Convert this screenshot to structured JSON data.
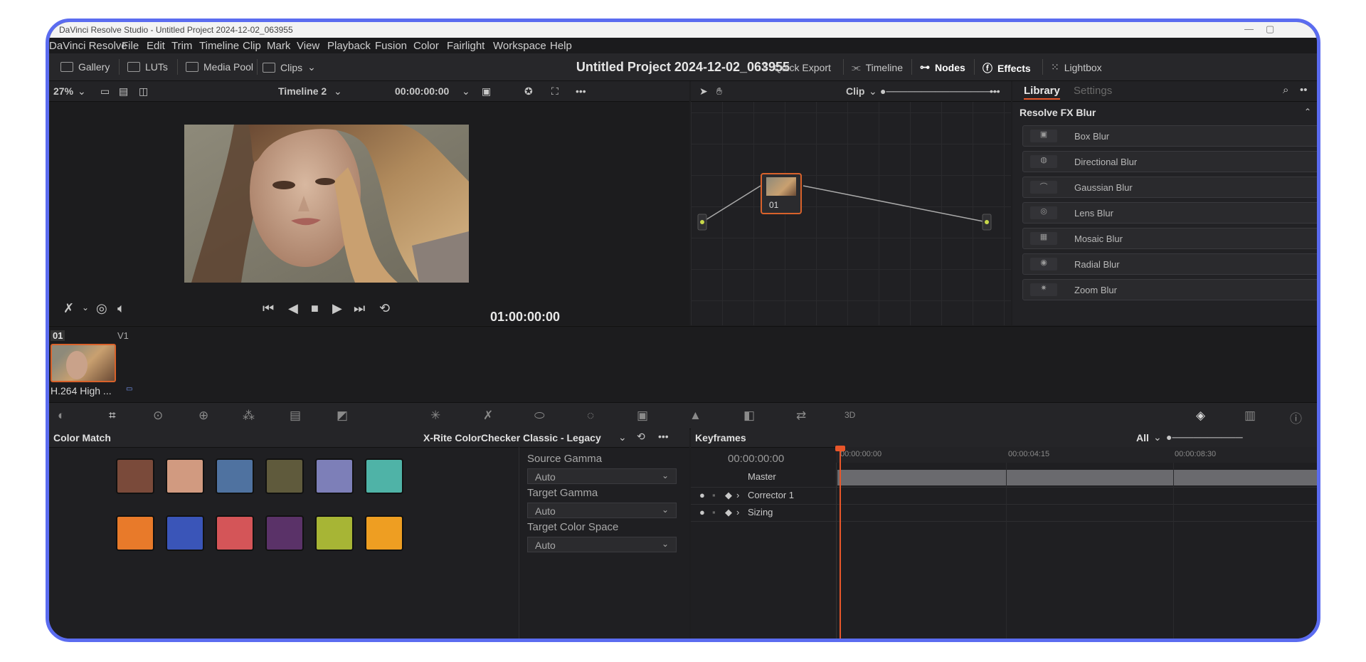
{
  "window": {
    "title": "DaVinci Resolve Studio - Untitled Project 2024-12-02_063955",
    "minimize": "—",
    "restore": "▢",
    "close": "✕"
  },
  "menu": [
    "DaVinci Resolve",
    "File",
    "Edit",
    "Trim",
    "Timeline",
    "Clip",
    "Mark",
    "View",
    "Playback",
    "Fusion",
    "Color",
    "Fairlight",
    "Workspace",
    "Help"
  ],
  "toolbar": {
    "gallery": "Gallery",
    "luts": "LUTs",
    "media_pool": "Media Pool",
    "clips": "Clips",
    "project_title": "Untitled Project 2024-12-02_063955",
    "quick_export": "Quick Export",
    "timeline": "Timeline",
    "nodes": "Nodes",
    "effects": "Effects",
    "lightbox": "Lightbox"
  },
  "viewer": {
    "zoom": "27%",
    "timeline_name": "Timeline 2",
    "timecode": "00:00:00:00",
    "playhead_timecode": "01:00:00:00",
    "clip_mode": "Clip"
  },
  "library": {
    "tab_library": "Library",
    "tab_settings": "Settings",
    "category": "Resolve FX Blur",
    "items": [
      "Box Blur",
      "Directional Blur",
      "Gaussian Blur",
      "Lens Blur",
      "Mosaic Blur",
      "Radial Blur",
      "Zoom Blur"
    ]
  },
  "node": {
    "label": "01"
  },
  "clip": {
    "number": "01",
    "track": "V1",
    "codec": "H.264 High ..."
  },
  "color_match": {
    "title": "Color Match",
    "chart": "X-Rite ColorChecker Classic - Legacy",
    "source_gamma_label": "Source Gamma",
    "source_gamma": "Auto",
    "target_gamma_label": "Target Gamma",
    "target_gamma": "Auto",
    "target_color_space_label": "Target Color Space",
    "target_color_space": "Auto",
    "swatches_row1": [
      "#7a4a3a",
      "#d19a80",
      "#4f72a0",
      "#5f5a3c",
      "#7d7fb8",
      "#4fb3a7"
    ],
    "swatches_row2": [
      "#e87a2a",
      "#3a55b8",
      "#d45558",
      "#5a3268",
      "#a7b535",
      "#ee9e22"
    ]
  },
  "keyframes": {
    "title": "Keyframes",
    "filter": "All",
    "timecode": "00:00:00:00",
    "ruler": [
      "00:00:00:00",
      "00:00:04:15",
      "00:00:08:30"
    ],
    "rows": [
      "Master",
      "Corrector 1",
      "Sizing"
    ]
  },
  "colors": {
    "accent": "#5b6cf0",
    "playhead": "#e8562a",
    "node_border": "#d9622b"
  }
}
